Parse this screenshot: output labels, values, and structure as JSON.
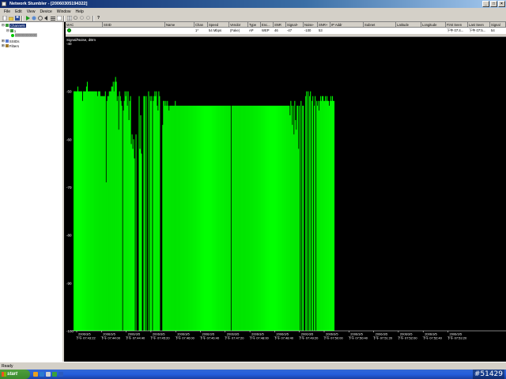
{
  "window": {
    "title": "Network Stumbler - [20060305194322]"
  },
  "menu": [
    "File",
    "Edit",
    "View",
    "Device",
    "Window",
    "Help"
  ],
  "tree": {
    "channels": "Channels",
    "channel1": "1",
    "ap": "00000000000",
    "ssids": "SSIDs",
    "filters": "Filters"
  },
  "columns": [
    "MAC",
    "SSID",
    "Name",
    "Chan",
    "Speed",
    "Vendor",
    "Type",
    "Enc...",
    "SNR",
    "Signal+",
    "Noise-",
    "SNR+",
    "IP Addr",
    "Subnet",
    "Latitude",
    "Longitude",
    "First Seen",
    "Last Seen",
    "Signal"
  ],
  "row": [
    "",
    "",
    "",
    "1*",
    "54 Mbps",
    "(Fake)",
    "AP",
    "WEP",
    "46",
    "-47",
    "-100",
    "53",
    "",
    "",
    "",
    "",
    "下午 07:4...",
    "下午 07:5...",
    "54"
  ],
  "graph": {
    "title": "Signal/Noise, dBm"
  },
  "status": {
    "text": "Ready"
  },
  "watermark": "#51429",
  "chart_data": {
    "type": "bar",
    "title": "Signal/Noise, dBm",
    "y_ticks": [
      "-40",
      "-50",
      "-60",
      "-70",
      "-80",
      "-90",
      "-100"
    ],
    "ylim": [
      -100,
      -40
    ],
    "bar_color": "#00ff00",
    "x_ticks": [
      [
        "2006/3/5",
        "下午 07:43:22"
      ],
      [
        "2006/3/5",
        "下午 07:44:00"
      ],
      [
        "2006/3/5",
        "下午 07:44:40"
      ],
      [
        "2006/3/5",
        "下午 07:45:20"
      ],
      [
        "2006/3/5",
        "下午 07:46:00"
      ],
      [
        "2006/3/5",
        "下午 07:46:40"
      ],
      [
        "2006/3/5",
        "下午 07:47:20"
      ],
      [
        "2006/3/5",
        "下午 07:48:00"
      ],
      [
        "2006/3/5",
        "下午 07:48:40"
      ],
      [
        "2006/3/5",
        "下午 07:49:20"
      ],
      [
        "2006/3/5",
        "下午 07:50:00"
      ],
      [
        "2006/3/5",
        "下午 07:50:40"
      ],
      [
        "2006/3/5",
        "下午 07:51:20"
      ],
      [
        "2006/3/5",
        "下午 07:52:00"
      ],
      [
        "2006/3/5",
        "下午 07:52:40"
      ],
      [
        "2006/3/5",
        "下午 07:53:20"
      ]
    ],
    "series": [
      {
        "values": [
          -50,
          -50,
          -50,
          -50,
          -50,
          -49,
          -50,
          -50,
          -50,
          -50,
          -50,
          -52,
          -50,
          -50,
          -50,
          -50,
          -49,
          -48,
          -50,
          -50,
          -50,
          -50,
          -50,
          -50,
          -50,
          -50,
          -50,
          -50,
          -50,
          -50,
          -51,
          -50,
          -50,
          -50,
          -51,
          -51,
          -51,
          -51,
          -51,
          -51,
          -50,
          -69,
          -52,
          -51,
          -51,
          -50,
          -50,
          -50,
          -49,
          -49,
          -48,
          -50,
          -48,
          -47,
          -48,
          -52,
          -51,
          -58,
          -50,
          -51,
          -52,
          -53,
          -100,
          -54,
          -52,
          -50,
          -51,
          -50,
          -53,
          -50,
          -56,
          -52,
          -51,
          -61,
          -59,
          -62,
          -60,
          -64,
          -100,
          -59,
          -100,
          -100,
          -100,
          -51,
          -62,
          -55,
          -63,
          -100,
          -100,
          -51,
          -51,
          -100,
          -51,
          -100,
          -100,
          -50,
          -100,
          -51,
          -52,
          -51,
          -100,
          -52,
          -51,
          -50,
          -51,
          -50,
          -53,
          -54,
          -50,
          -51,
          -100,
          -100,
          -100,
          -57,
          -52,
          -52,
          -53,
          -52,
          -53,
          -52,
          -53,
          -54,
          -53,
          -53,
          -53,
          -53,
          -53,
          -53,
          -53,
          -52,
          -53,
          -53,
          -53,
          -53,
          -53,
          -53,
          -53,
          -53,
          -53,
          -53,
          -53,
          -53,
          -53,
          -53,
          -53,
          -53,
          -53,
          -53,
          -53,
          -53,
          -53,
          -53,
          -53,
          -53,
          -53,
          -53,
          -53,
          -53,
          -53,
          -53,
          -53,
          -53,
          -53,
          -53,
          -53,
          -53,
          -53,
          -53,
          -53,
          -53,
          -53,
          -53,
          -53,
          -53,
          -53,
          -53,
          -53,
          -53,
          -53,
          -53,
          -53,
          -53,
          -53,
          -53,
          -53,
          -53,
          -53,
          -53,
          -53,
          -53,
          -53,
          -53,
          -53,
          -53,
          -53,
          -53,
          -53,
          -53,
          -53,
          -53,
          -100,
          -53,
          -53,
          -53,
          -53,
          -53,
          -53,
          -53,
          -53,
          -53,
          -53,
          -53,
          -53,
          -53,
          -53,
          -53,
          -53,
          -53,
          -53,
          -53,
          -53,
          -53,
          -53,
          -53,
          -53,
          -53,
          -53,
          -53,
          -53,
          -53,
          -53,
          -53,
          -53,
          -53,
          -53,
          -53,
          -53,
          -53,
          -53,
          -53,
          -53,
          -53,
          -53,
          -53,
          -53,
          -53,
          -53,
          -53,
          -53,
          -53,
          -53,
          -53,
          -53,
          -53,
          -53,
          -53,
          -53,
          -53,
          -53,
          -53,
          -53,
          -53,
          -53,
          -53,
          -53,
          -53,
          -53,
          -53,
          -53,
          -53,
          -53,
          -53,
          -53,
          -53,
          -53,
          -55,
          -52,
          -53,
          -57,
          -53,
          -59,
          -52,
          -56,
          -58,
          -53,
          -53,
          -62,
          -53,
          -100,
          -52,
          -100,
          -53,
          -53,
          -100,
          -100,
          -51,
          -50,
          -100,
          -50,
          -100,
          -51,
          -50,
          -100,
          -52,
          -51,
          -100,
          -53,
          -51,
          -100,
          -52,
          -53,
          -52,
          -54,
          -52,
          -51,
          -52,
          -51,
          -51,
          -52,
          -52,
          -51,
          -52,
          -51,
          -52,
          -52,
          -53,
          -52,
          -51,
          -52,
          -51,
          -52,
          -52
        ]
      }
    ]
  }
}
